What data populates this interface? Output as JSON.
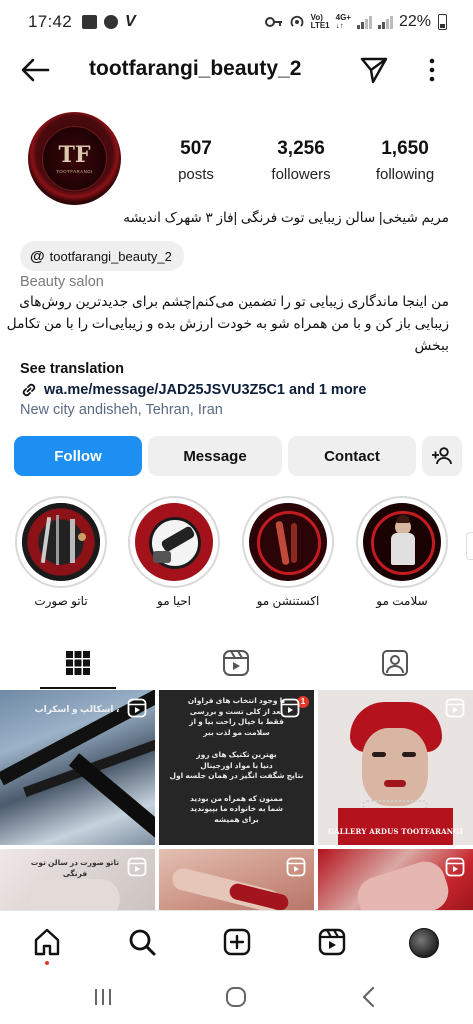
{
  "status_bar": {
    "time": "17:42",
    "network_top": "Vo)",
    "network_bottom": "LTE1",
    "lte_label": "4G+",
    "battery": "22%"
  },
  "header": {
    "username": "tootfarangi_beauty_2"
  },
  "profile": {
    "avatar_logo": "TF",
    "avatar_text": "TOOTFARANGI",
    "stats": [
      {
        "value": "507",
        "label": "posts"
      },
      {
        "value": "3,256",
        "label": "followers"
      },
      {
        "value": "1,650",
        "label": "following"
      }
    ],
    "name": "مریم شیخی| سالن زیبایی توت فرنگی |فاز ۳ شهرک اندیشه",
    "threads_handle": "tootfarangi_beauty_2",
    "threads_icon": "@",
    "category": "Beauty salon",
    "bio_lines": [
      "من اینجا ماندگاری زیبایی تو را تضمین می‌کنم|چشم برای جدیدترین روش‌های",
      "زیبایی باز کن و با من همراه شو به خودت ارزش بده و زیبایی‌ات را با من تکامل",
      "ببخش"
    ],
    "see_translation": "See translation",
    "link": "wa.me/message/JAD25JSVU3Z5C1 and 1 more",
    "location": "New city andisheh, Tehran, Iran"
  },
  "buttons": {
    "follow": "Follow",
    "message": "Message",
    "contact": "Contact"
  },
  "highlights": [
    {
      "label": "تاتو صورت"
    },
    {
      "label": "احیا مو"
    },
    {
      "label": "اکستنشن مو"
    },
    {
      "label": "سلامت مو"
    }
  ],
  "posts": {
    "p1_text": "، اسکالپ و اسکراب",
    "p2_lines": [
      "با وجود انتخاب های فراوان",
      "بعد از کلی تست و بررسی",
      "فقط با خیال راحت بیا و از",
      "سلامت مو لذت ببر",
      "بهترین تکنیک های روز",
      "دنیا با مواد اورجینال",
      "نتایج شگفت انگیز در همان جلسه اول",
      "",
      "ممنون که همراه من بودید",
      "شما به خانواده ما بپیوندید",
      "برای همیشه"
    ],
    "p3_caption": "GALLERY ARDUS TOOTFARANGI",
    "p4_text": "تاتو صورت در سالن توت فرنگی",
    "p2_badge": "1"
  },
  "colors": {
    "accent": "#1d8ff3",
    "brand_dark_red": "#4b0a0e",
    "link_blue": "#0d1d3a"
  }
}
